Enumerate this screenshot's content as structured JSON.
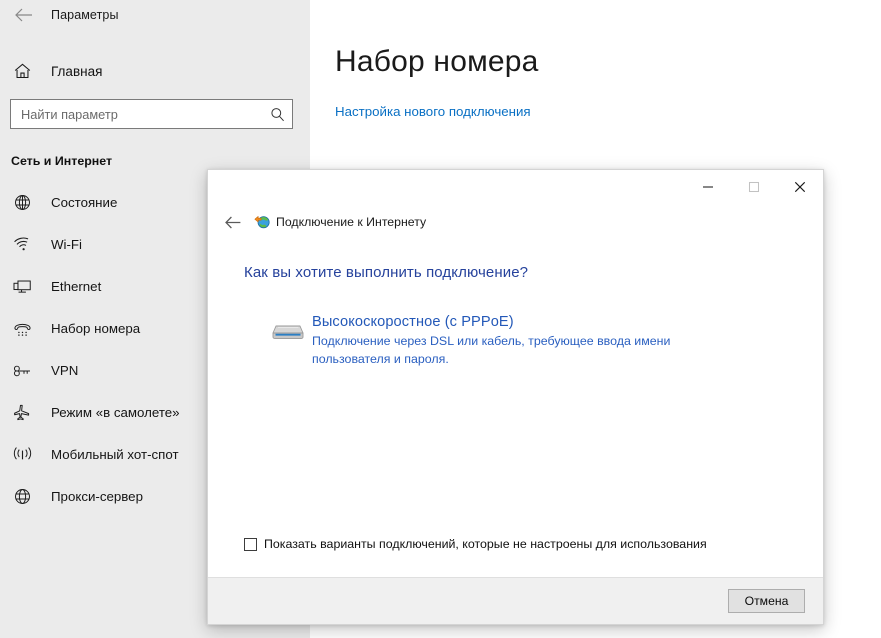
{
  "settings": {
    "back_icon": "back-arrow-icon",
    "app_title": "Параметры",
    "home_icon": "home-icon",
    "home_label": "Главная",
    "search": {
      "placeholder": "Найти параметр",
      "value": "",
      "icon": "search-icon"
    },
    "section_title": "Сеть и Интернет",
    "nav_items": [
      {
        "icon": "globe-icon",
        "label": "Состояние"
      },
      {
        "icon": "wifi-icon",
        "label": "Wi-Fi"
      },
      {
        "icon": "ethernet-icon",
        "label": "Ethernet"
      },
      {
        "icon": "phone-dial-icon",
        "label": "Набор номера"
      },
      {
        "icon": "vpn-key-icon",
        "label": "VPN"
      },
      {
        "icon": "airplane-icon",
        "label": "Режим «в самолете»"
      },
      {
        "icon": "hotspot-icon",
        "label": "Мобильный хот-спот"
      },
      {
        "icon": "proxy-globe-icon",
        "label": "Прокси-сервер"
      }
    ],
    "page_title": "Набор номера",
    "content_link": "Настройка нового подключения"
  },
  "dialog": {
    "window_controls": {
      "minimize": "minimize-icon",
      "maximize": "maximize-icon",
      "close": "close-icon"
    },
    "back_icon": "back-arrow-icon",
    "title_icon": "internet-globe-icon",
    "title": "Подключение к Интернету",
    "question": "Как вы хотите выполнить подключение?",
    "options": [
      {
        "icon": "modem-icon",
        "title": "Высокоскоростное (с PPPoE)",
        "description": "Подключение через DSL или кабель, требующее ввода имени пользователя и пароля."
      }
    ],
    "checkbox": {
      "label": "Показать варианты подключений, которые не настроены для использования",
      "checked": false
    },
    "cancel_button": "Отмена"
  },
  "colors": {
    "accent_link": "#0a70c4",
    "dialog_heading": "#26429c",
    "option_link": "#2358b8",
    "sidebar_bg": "#ebebeb"
  }
}
